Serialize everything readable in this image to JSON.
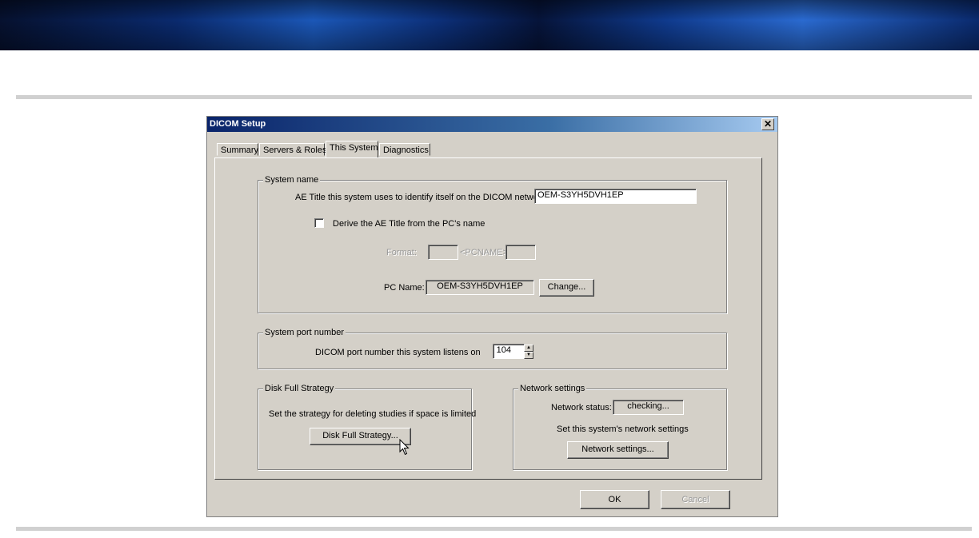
{
  "dialog": {
    "title": "DICOM Setup",
    "close_icon": "close-icon"
  },
  "tabs": [
    {
      "label": "Summary"
    },
    {
      "label": "Servers & Roles"
    },
    {
      "label": "This System",
      "active": true
    },
    {
      "label": "Diagnostics"
    }
  ],
  "system_name": {
    "legend": "System name",
    "ae_title_label": "AE Title this system uses to identify itself on the DICOM network:",
    "ae_title_value": "OEM-S3YH5DVH1EP",
    "derive_label": "Derive the AE Title from the PC's name",
    "derive_checked": false,
    "format_label": "Format:",
    "format_prefix": "",
    "format_middle": "<PCNAME>",
    "format_suffix": "",
    "pc_name_label": "PC Name:",
    "pc_name_value": "OEM-S3YH5DVH1EP",
    "change_button": "Change..."
  },
  "port": {
    "legend": "System port number",
    "label": "DICOM port number this system listens on",
    "value": "104"
  },
  "disk_full": {
    "legend": "Disk Full Strategy",
    "description": "Set the strategy for deleting studies if space is limited",
    "button": "Disk Full Strategy..."
  },
  "network": {
    "legend": "Network settings",
    "status_label": "Network status:",
    "status_value": "checking...",
    "description": "Set this system's network settings",
    "button": "Network settings..."
  },
  "footer": {
    "ok": "OK",
    "cancel": "Cancel"
  },
  "colors": {
    "dialog_bg": "#d4d0c8",
    "titlebar_start": "#0a246a",
    "titlebar_end": "#a6caf0"
  }
}
